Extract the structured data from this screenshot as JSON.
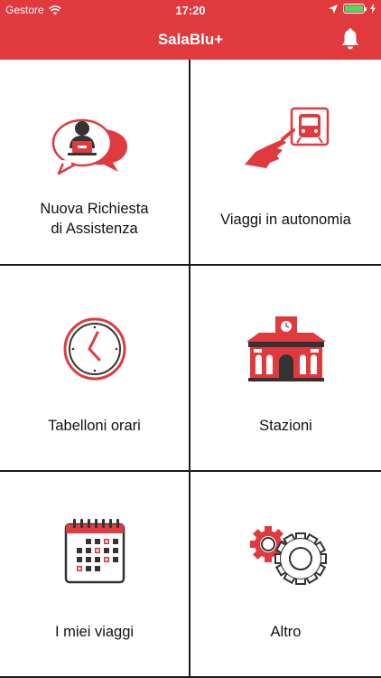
{
  "status_bar": {
    "carrier": "Gestore",
    "time": "17:20"
  },
  "header": {
    "title": "SalaBlu+"
  },
  "menu": [
    {
      "label_line1": "Nuova Richiesta",
      "label_line2": "di Assistenza",
      "icon": "assistance-request-icon"
    },
    {
      "label_line1": "Viaggi in autonomia",
      "label_line2": "",
      "icon": "autonomous-travel-icon"
    },
    {
      "label_line1": "Tabelloni orari",
      "label_line2": "",
      "icon": "clock-icon"
    },
    {
      "label_line1": "Stazioni",
      "label_line2": "",
      "icon": "station-icon"
    },
    {
      "label_line1": "I miei viaggi",
      "label_line2": "",
      "icon": "calendar-icon"
    },
    {
      "label_line1": "Altro",
      "label_line2": "",
      "icon": "gears-icon"
    }
  ],
  "colors": {
    "brand": "#e03a3e",
    "dark": "#333333",
    "text": "#111111"
  }
}
